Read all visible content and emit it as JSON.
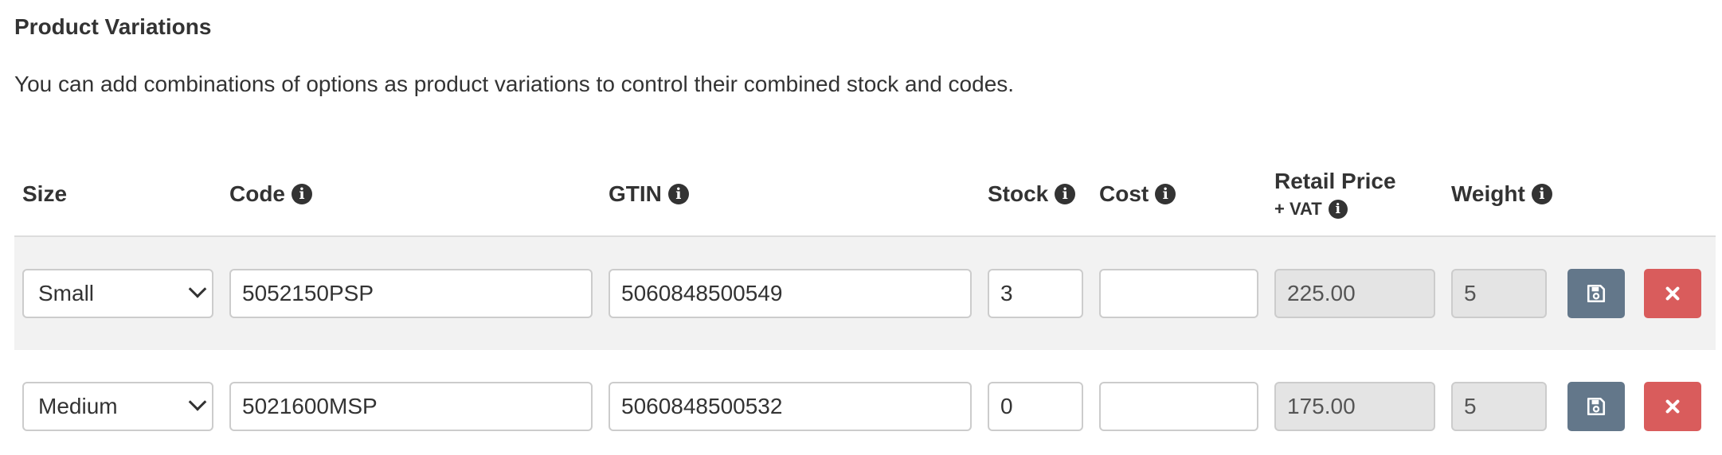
{
  "section": {
    "title": "Product Variations",
    "description": "You can add combinations of options as product variations to control their combined stock and codes."
  },
  "columns": {
    "size": "Size",
    "code": "Code",
    "gtin": "GTIN",
    "stock": "Stock",
    "cost": "Cost",
    "retail_price": "Retail Price",
    "retail_price_sub": "+ VAT",
    "weight": "Weight"
  },
  "rows": [
    {
      "size": "Small",
      "code": "5052150PSP",
      "gtin": "5060848500549",
      "stock": "3",
      "cost": "",
      "retail_price": "225.00",
      "weight": "5"
    },
    {
      "size": "Medium",
      "code": "5021600MSP",
      "gtin": "5060848500532",
      "stock": "0",
      "cost": "",
      "retail_price": "175.00",
      "weight": "5"
    }
  ],
  "icons": {
    "info": "info-icon",
    "save": "floppy-disk-icon",
    "delete": "close-icon"
  },
  "colors": {
    "save_button": "#63778a",
    "delete_button": "#d95c5c",
    "striped_row": "#f2f2f2",
    "readonly_field": "#e4e4e4"
  }
}
